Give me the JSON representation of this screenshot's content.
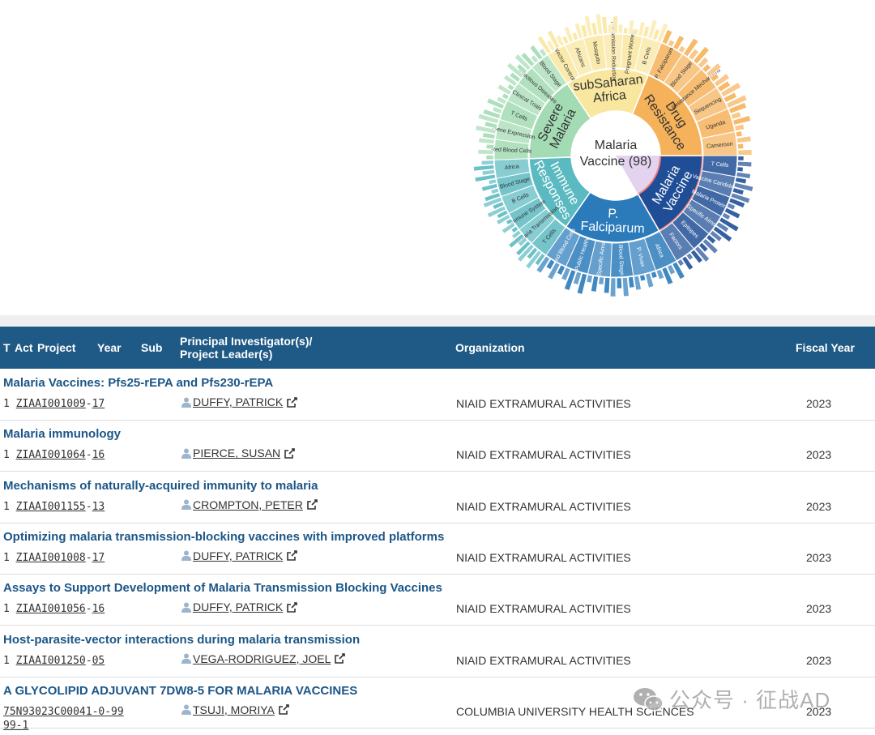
{
  "sunburst": {
    "center_label_1": "Malaria",
    "center_label_2": "Vaccine (98)",
    "inner": [
      {
        "label": "Malaria Vaccine",
        "color": "#1f4e96"
      },
      {
        "label": "P. Falciparum",
        "color": "#2b7bbb"
      },
      {
        "label": "Immune Responses",
        "color": "#5bbac1"
      },
      {
        "label": "Severe Malaria",
        "color": "#a3dbb4"
      },
      {
        "label": "subSaharan Africa",
        "color": "#f9e79f"
      },
      {
        "label": "Drug Resistance",
        "color": "#f5b25a"
      }
    ],
    "outer_labels": {
      "vaccine": [
        "T Cells",
        "Vaccine Candidates",
        "Malaria Proteins",
        "Specific Aims",
        "Epitopes",
        "Factors"
      ],
      "falciparum": [
        "Africa",
        "P. Vivax",
        "Blood Stage",
        "Specific Aims",
        "Public Health",
        "Red Blood Cells"
      ],
      "immune": [
        "T Cells",
        "Malaria Transmission",
        "Immune System",
        "B Cells",
        "Blood Stage",
        "Africa"
      ],
      "severe": [
        "Red Blood Cells",
        "Gene Expression",
        "T Cells",
        "Clinical Trials",
        "Infectious Diseases",
        "Blood Stage"
      ],
      "africa": [
        "Vector Control",
        "Africans",
        "Mosquito",
        "Transmission Reduction",
        "Pregnant Women",
        "B Cells"
      ],
      "drug": [
        "P. Falciparum",
        "Blood Stage",
        "Resistance Mechanisms",
        "Sequencing",
        "Uganda",
        "Cameroon"
      ]
    }
  },
  "table": {
    "headers": {
      "type": "T",
      "act": "Act",
      "project": "Project",
      "year": "Year",
      "sub": "Sub",
      "pi": "Principal Investigator(s)/\nProject Leader(s)",
      "org": "Organization",
      "fy": "Fiscal Year"
    },
    "rows": [
      {
        "title": "Malaria Vaccines: Pfs25-rEPA and Pfs230-rEPA",
        "type": "1",
        "code": "ZIAAI001009",
        "suffix": "17",
        "pi": "DUFFY, PATRICK",
        "org": "NIAID EXTRAMURAL ACTIVITIES",
        "fy": "2023"
      },
      {
        "title": "Malaria immunology",
        "type": "1",
        "code": "ZIAAI001064",
        "suffix": "16",
        "pi": "PIERCE, SUSAN",
        "org": "NIAID EXTRAMURAL ACTIVITIES",
        "fy": "2023"
      },
      {
        "title": "Mechanisms of naturally-acquired immunity to malaria",
        "type": "1",
        "code": "ZIAAI001155",
        "suffix": "13",
        "pi": "CROMPTON, PETER",
        "org": "NIAID EXTRAMURAL ACTIVITIES",
        "fy": "2023"
      },
      {
        "title": "Optimizing malaria transmission-blocking vaccines with improved platforms",
        "type": "1",
        "code": "ZIAAI001008",
        "suffix": "17",
        "pi": "DUFFY, PATRICK",
        "org": "NIAID EXTRAMURAL ACTIVITIES",
        "fy": "2023"
      },
      {
        "title": "Assays to Support Development of Malaria Transmission Blocking Vaccines",
        "type": "1",
        "code": "ZIAAI001056",
        "suffix": "16",
        "pi": "DUFFY, PATRICK",
        "org": "NIAID EXTRAMURAL ACTIVITIES",
        "fy": "2023"
      },
      {
        "title": "Host-parasite-vector interactions during malaria transmission",
        "type": "1",
        "code": "ZIAAI001250",
        "suffix": "05",
        "pi": "VEGA-RODRIGUEZ, JOEL",
        "org": "NIAID EXTRAMURAL ACTIVITIES",
        "fy": "2023"
      },
      {
        "title": "A GLYCOLIPID ADJUVANT 7DW8-5 FOR MALARIA VACCINES",
        "type": "",
        "code": "75N93023C00041-0-99",
        "suffix": "99-1",
        "pi": "TSUJI, MORIYA",
        "org": "COLUMBIA UNIVERSITY HEALTH SCIENCES",
        "fy": "2023"
      }
    ]
  },
  "watermark": {
    "text": "公众号 · 征战AD"
  }
}
